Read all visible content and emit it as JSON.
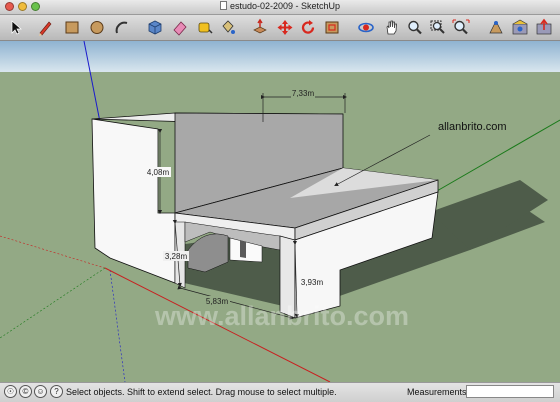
{
  "window": {
    "title": "estudo-02-2009 - SketchUp"
  },
  "toolbar": {
    "tools": [
      {
        "name": "select",
        "icon": "arrow-cursor-icon"
      },
      {
        "name": "line",
        "icon": "pencil-icon"
      },
      {
        "name": "rectangle",
        "icon": "rectangle-icon"
      },
      {
        "name": "circle",
        "icon": "circle-icon"
      },
      {
        "name": "arc",
        "icon": "arc-icon"
      },
      {
        "name": "make-component",
        "icon": "component-icon"
      },
      {
        "name": "eraser",
        "icon": "eraser-icon"
      },
      {
        "name": "tape-measure",
        "icon": "tape-measure-icon"
      },
      {
        "name": "paint-bucket",
        "icon": "paint-bucket-icon"
      },
      {
        "name": "push-pull",
        "icon": "push-pull-icon"
      },
      {
        "name": "move",
        "icon": "move-icon"
      },
      {
        "name": "rotate",
        "icon": "rotate-icon"
      },
      {
        "name": "offset",
        "icon": "offset-icon"
      },
      {
        "name": "orbit",
        "icon": "orbit-icon"
      },
      {
        "name": "pan",
        "icon": "hand-icon"
      },
      {
        "name": "zoom",
        "icon": "zoom-icon"
      },
      {
        "name": "zoom-window",
        "icon": "zoom-window-icon"
      },
      {
        "name": "zoom-extents",
        "icon": "zoom-extents-icon"
      },
      {
        "name": "position-camera",
        "icon": "position-camera-icon"
      },
      {
        "name": "get-models",
        "icon": "warehouse-icon"
      },
      {
        "name": "share-model",
        "icon": "share-model-icon"
      }
    ]
  },
  "viewport": {
    "dimensions": {
      "top_width": "7,33m",
      "upper_height": "4,08m",
      "lower_height": "3,28m",
      "base_width": "5,83m",
      "front_height": "3,93m"
    },
    "annotation": "allanbrito.com",
    "watermark": "www.allanbrito.com",
    "colors": {
      "sky": "#a9c4da",
      "ground": "#93a985",
      "shadow": "#4c5a48",
      "face_light": "#f7f7f7",
      "face_gray": "#a2a2a2"
    }
  },
  "statusbar": {
    "status_text": "Select objects. Shift to extend select. Drag mouse to select multiple.",
    "measurements_label": "Measurements",
    "measurements_value": "",
    "icons": [
      "geo-location-icon",
      "credits-icon",
      "user-icon",
      "help-icon"
    ]
  }
}
